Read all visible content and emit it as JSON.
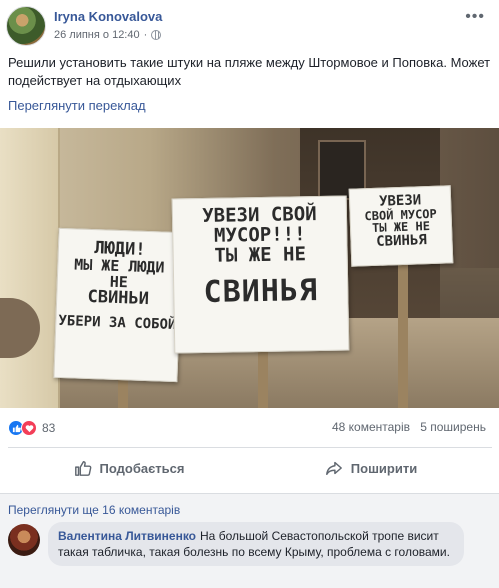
{
  "post": {
    "author": "Iryna Konovalova",
    "date": "26 липня о 12:40",
    "text": "Решили установить такие штуки на пляже между Штормовое и Поповка. Может подействует на отдыхающих",
    "translate_link": "Переглянути переклад",
    "more_icon": "more-options-icon",
    "privacy_icon": "globe-icon"
  },
  "photo": {
    "sign_left": [
      "ЛЮДИ!",
      "МЫ ЖЕ ЛЮДИ",
      "НЕ",
      "СВИНЬИ",
      "УБЕРИ ЗА СОБОЙ"
    ],
    "sign_center": [
      "УВЕЗИ СВОЙ",
      "МУСОР!!!",
      "ТЫ ЖЕ НЕ",
      "СВИНЬЯ"
    ],
    "sign_right": [
      "УВЕЗИ",
      "СВОЙ МУСОР",
      "ТЫ ЖЕ НЕ",
      "СВИНЬЯ"
    ]
  },
  "stats": {
    "reactions_count": "83",
    "comments": "48 коментарів",
    "shares": "5 поширень",
    "reaction_icons": [
      "like-icon",
      "love-icon"
    ]
  },
  "actions": {
    "like_label": "Подобається",
    "share_label": "Поширити"
  },
  "comments": {
    "more_link": "Переглянути ще 16 коментарів",
    "items": [
      {
        "author": "Валентина Литвиненко",
        "text": "На большой Севастопольской тропе висит такая табличка, такая болезнь по всему Крыму, проблема с головами."
      }
    ]
  },
  "colors": {
    "link": "#385898",
    "like": "#1877f2",
    "love": "#f33e58"
  }
}
